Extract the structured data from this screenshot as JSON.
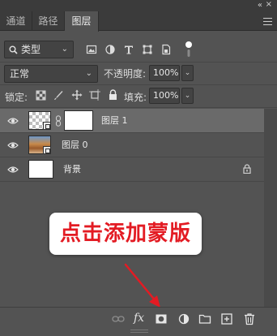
{
  "panel": {
    "collapse_glyph": "«",
    "close_glyph": "×"
  },
  "tabs": [
    {
      "label": "通道",
      "active": false
    },
    {
      "label": "路径",
      "active": false
    },
    {
      "label": "图层",
      "active": true
    }
  ],
  "filter": {
    "kind_label": "类型",
    "buttons": [
      "image-filter-icon",
      "adjustment-filter-icon",
      "type-filter-icon",
      "shape-filter-icon",
      "smartobject-filter-icon",
      "filter-toggle-icon"
    ]
  },
  "blend": {
    "mode": "正常",
    "opacity_label": "不透明度:",
    "opacity_value": "100%"
  },
  "lock": {
    "label": "锁定:",
    "fill_label": "填充:",
    "fill_value": "100%"
  },
  "layers": [
    {
      "name": "图层 1",
      "selected": true,
      "thumb": "checker-smart",
      "has_mask": true,
      "locked": false
    },
    {
      "name": "图层 0",
      "selected": false,
      "thumb": "photo-smart",
      "has_mask": false,
      "locked": false
    },
    {
      "name": "背景",
      "selected": false,
      "thumb": "white",
      "has_mask": false,
      "locked": true
    }
  ],
  "annotation": {
    "text": "点击添加蒙版",
    "color": "#e31b23"
  },
  "footer": {
    "icons": [
      "link-layers-icon",
      "fx-icon",
      "add-mask-icon",
      "adjustment-layer-icon",
      "new-group-icon",
      "new-layer-icon",
      "delete-layer-icon"
    ],
    "fx_label": "fx"
  },
  "colors": {
    "panel_bg": "#535353",
    "header_bg": "#3b3b3b",
    "selected_row": "#6a6a6a",
    "annotation_red": "#e31b23"
  }
}
